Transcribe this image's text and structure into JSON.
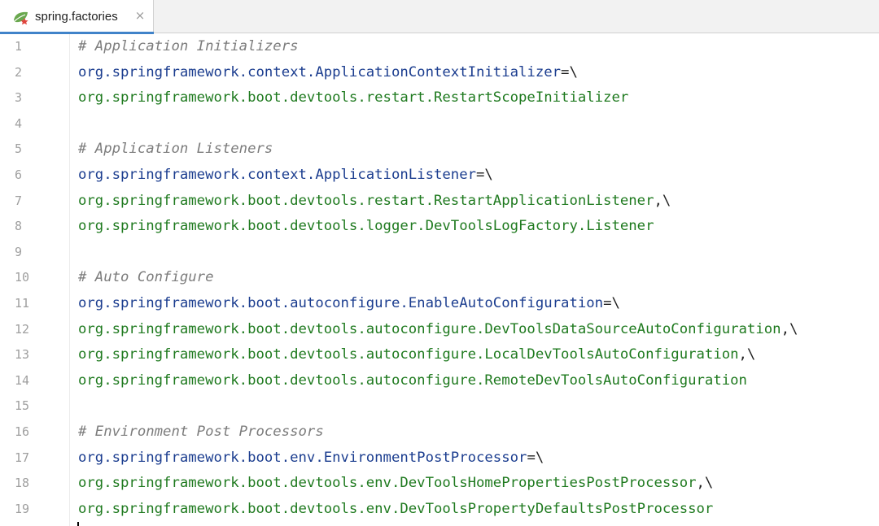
{
  "tab": {
    "title": "spring.factories",
    "close_glyph": "×",
    "icon": "spring-leaf-icon"
  },
  "colors": {
    "comment": "#7c7c7c",
    "key": "#1b3d8f",
    "value": "#1f7a1f",
    "tab_accent": "#4083c9"
  },
  "lines": [
    {
      "n": "1",
      "parts": [
        {
          "t": "comment",
          "v": "# Application Initializers"
        }
      ]
    },
    {
      "n": "2",
      "parts": [
        {
          "t": "key",
          "v": "org.springframework.context.ApplicationContextInitializer"
        },
        {
          "t": "op",
          "v": "=\\"
        }
      ]
    },
    {
      "n": "3",
      "parts": [
        {
          "t": "val",
          "v": "org.springframework.boot.devtools.restart.RestartScopeInitializer"
        }
      ]
    },
    {
      "n": "4",
      "parts": []
    },
    {
      "n": "5",
      "parts": [
        {
          "t": "comment",
          "v": "# Application Listeners"
        }
      ]
    },
    {
      "n": "6",
      "parts": [
        {
          "t": "key",
          "v": "org.springframework.context.ApplicationListener"
        },
        {
          "t": "op",
          "v": "=\\"
        }
      ]
    },
    {
      "n": "7",
      "parts": [
        {
          "t": "val",
          "v": "org.springframework.boot.devtools.restart.RestartApplicationListener"
        },
        {
          "t": "op",
          "v": ",\\"
        }
      ]
    },
    {
      "n": "8",
      "parts": [
        {
          "t": "val",
          "v": "org.springframework.boot.devtools.logger.DevToolsLogFactory.Listener"
        }
      ]
    },
    {
      "n": "9",
      "parts": []
    },
    {
      "n": "10",
      "parts": [
        {
          "t": "comment",
          "v": "# Auto Configure"
        }
      ]
    },
    {
      "n": "11",
      "parts": [
        {
          "t": "key",
          "v": "org.springframework.boot.autoconfigure.EnableAutoConfiguration"
        },
        {
          "t": "op",
          "v": "=\\"
        }
      ]
    },
    {
      "n": "12",
      "parts": [
        {
          "t": "val",
          "v": "org.springframework.boot.devtools.autoconfigure.DevToolsDataSourceAutoConfiguration"
        },
        {
          "t": "op",
          "v": ",\\"
        }
      ]
    },
    {
      "n": "13",
      "parts": [
        {
          "t": "val",
          "v": "org.springframework.boot.devtools.autoconfigure.LocalDevToolsAutoConfiguration"
        },
        {
          "t": "op",
          "v": ",\\"
        }
      ]
    },
    {
      "n": "14",
      "parts": [
        {
          "t": "val",
          "v": "org.springframework.boot.devtools.autoconfigure.RemoteDevToolsAutoConfiguration"
        }
      ]
    },
    {
      "n": "15",
      "parts": []
    },
    {
      "n": "16",
      "parts": [
        {
          "t": "comment",
          "v": "# Environment Post Processors"
        }
      ]
    },
    {
      "n": "17",
      "parts": [
        {
          "t": "key",
          "v": "org.springframework.boot.env.EnvironmentPostProcessor"
        },
        {
          "t": "op",
          "v": "=\\"
        }
      ]
    },
    {
      "n": "18",
      "parts": [
        {
          "t": "val",
          "v": "org.springframework.boot.devtools.env.DevToolsHomePropertiesPostProcessor"
        },
        {
          "t": "op",
          "v": ",\\"
        }
      ]
    },
    {
      "n": "19",
      "parts": [
        {
          "t": "val",
          "v": "org.springframework.boot.devtools.env.DevToolsPropertyDefaultsPostProcessor"
        }
      ]
    }
  ]
}
